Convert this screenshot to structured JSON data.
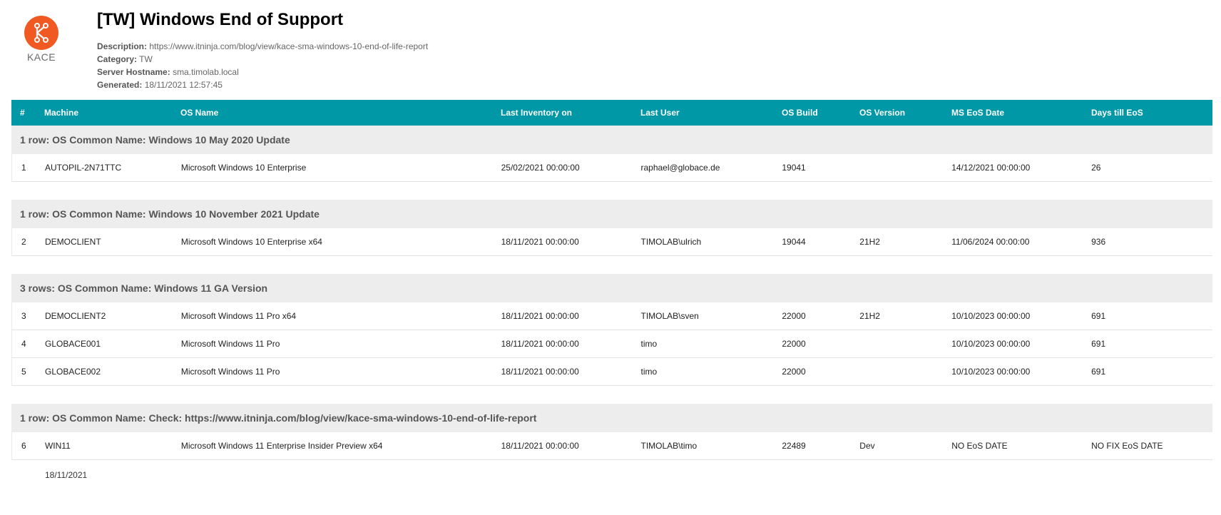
{
  "logo": {
    "text": "KACE",
    "color": "#f05a22"
  },
  "report": {
    "title": "[TW] Windows End of Support",
    "meta": [
      {
        "label": "Description:",
        "value": "https://www.itninja.com/blog/view/kace-sma-windows-10-end-of-life-report"
      },
      {
        "label": "Category:",
        "value": "TW"
      },
      {
        "label": "Server Hostname:",
        "value": "sma.timolab.local"
      },
      {
        "label": "Generated:",
        "value": "18/11/2021 12:57:45"
      }
    ]
  },
  "table": {
    "header_color": "#0097a7",
    "columns": [
      "#",
      "Machine",
      "OS Name",
      "Last Inventory on",
      "Last User",
      "OS Build",
      "OS Version",
      "MS EoS Date",
      "Days till EoS"
    ],
    "groups": [
      {
        "title": "1 row: OS Common Name: Windows 10 May 2020 Update",
        "rows": [
          [
            "1",
            "AUTOPIL-2N71TTC",
            "Microsoft Windows 10 Enterprise",
            "25/02/2021 00:00:00",
            "raphael@globace.de",
            "19041",
            "",
            "14/12/2021 00:00:00",
            "26"
          ]
        ]
      },
      {
        "title": "1 row: OS Common Name: Windows 10 November 2021 Update",
        "rows": [
          [
            "2",
            "DEMOCLIENT",
            "Microsoft Windows 10 Enterprise x64",
            "18/11/2021 00:00:00",
            "TIMOLAB\\ulrich",
            "19044",
            "21H2",
            "11/06/2024 00:00:00",
            "936"
          ]
        ]
      },
      {
        "title": "3 rows: OS Common Name: Windows 11 GA Version",
        "rows": [
          [
            "3",
            "DEMOCLIENT2",
            "Microsoft Windows 11 Pro x64",
            "18/11/2021 00:00:00",
            "TIMOLAB\\sven",
            "22000",
            "21H2",
            "10/10/2023 00:00:00",
            "691"
          ],
          [
            "4",
            "GLOBACE001",
            "Microsoft Windows 11 Pro",
            "18/11/2021 00:00:00",
            "timo",
            "22000",
            "",
            "10/10/2023 00:00:00",
            "691"
          ],
          [
            "5",
            "GLOBACE002",
            "Microsoft Windows 11 Pro",
            "18/11/2021 00:00:00",
            "timo",
            "22000",
            "",
            "10/10/2023 00:00:00",
            "691"
          ]
        ]
      },
      {
        "title": "1 row: OS Common Name: Check: https://www.itninja.com/blog/view/kace-sma-windows-10-end-of-life-report",
        "rows": [
          [
            "6",
            "WIN11",
            "Microsoft Windows 11 Enterprise Insider Preview x64",
            "18/11/2021 00:00:00",
            "TIMOLAB\\timo",
            "22489",
            "Dev",
            "NO EoS DATE",
            "NO FIX EoS DATE"
          ]
        ]
      }
    ]
  },
  "footer": {
    "date": "18/11/2021"
  }
}
